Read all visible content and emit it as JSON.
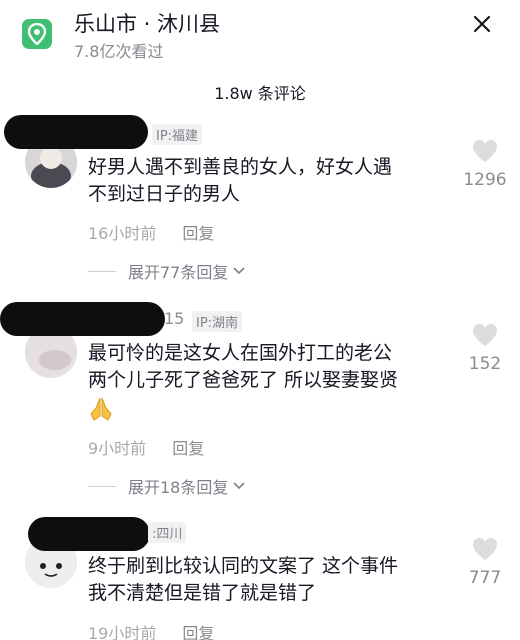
{
  "header": {
    "location_title": "乐山市 · 沐川县",
    "views": "7.8亿次看过"
  },
  "comments_header": {
    "count_label": "1.8w  条评论"
  },
  "comments": [
    {
      "ip": "IP:福建",
      "text_line1": "好男人遇不到善良的女人，好女人遇",
      "text_line2": "不到过日子的男人",
      "time": "16小时前",
      "reply": "回复",
      "expand": "展开77条回复",
      "likes": "1296"
    },
    {
      "username_tail": "15",
      "ip": "IP:湖南",
      "text_line1": "最可怜的是这女人在国外打工的老公",
      "text_line2": "两个儿子死了爸爸死了  所以娶妻娶贤",
      "emoji": "pray-emoji",
      "time": "9小时前",
      "reply": "回复",
      "expand": "展开18条回复",
      "likes": "152"
    },
    {
      "ip": ":四川",
      "text_line1": "终于刷到比较认同的文案了  这个事件",
      "text_line2": "我不清楚但是错了就是错了",
      "time": "19小时前",
      "reply": "回复",
      "likes": "777"
    }
  ],
  "icons": {
    "location": "location-pin-icon",
    "close": "close-icon",
    "like": "heart-icon"
  },
  "colors": {
    "location_icon_bg": "#3fbf72",
    "text_primary": "#161823",
    "text_secondary": "#8a8b91"
  }
}
